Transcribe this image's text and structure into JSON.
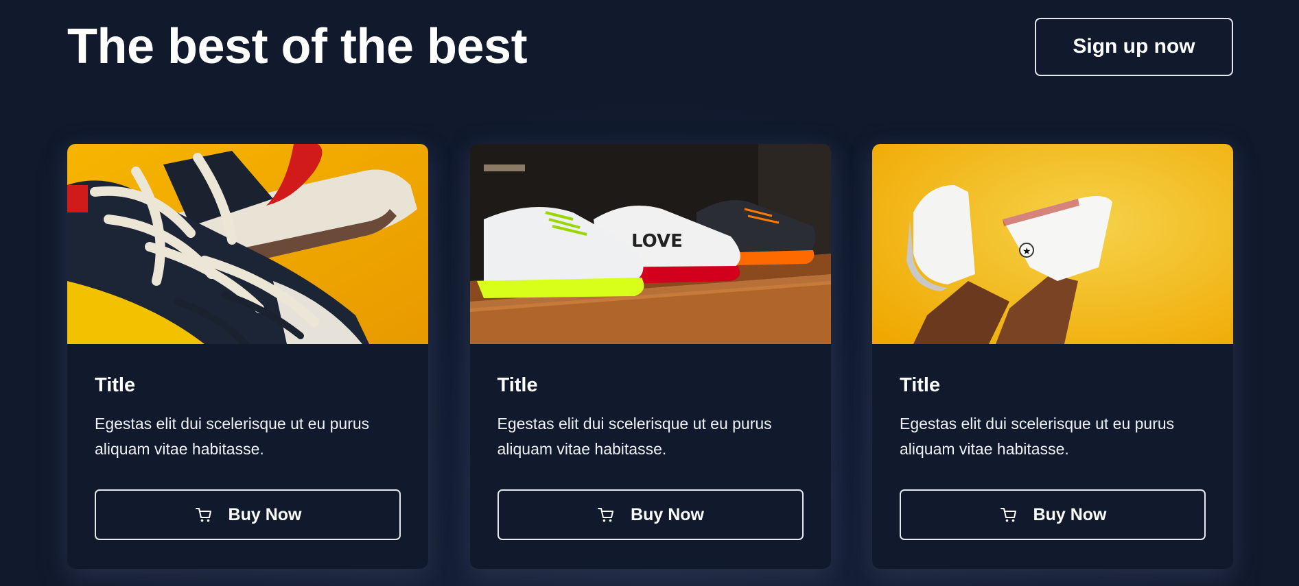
{
  "header": {
    "title": "The best of the best",
    "signup_label": "Sign up now"
  },
  "cards": [
    {
      "title": "Title",
      "description": "Egestas elit dui scelerisque ut eu purus aliquam vitae habitasse.",
      "button_label": "Buy Now",
      "button_icon": "cart-icon",
      "image": "sneaker-closeup-yellow-photo"
    },
    {
      "title": "Title",
      "description": "Egestas elit dui scelerisque ut eu purus aliquam vitae habitasse.",
      "button_label": "Buy Now",
      "button_icon": "cart-icon",
      "image": "sneakers-on-shelf-photo",
      "image_text": "LOVE"
    },
    {
      "title": "Title",
      "description": "Egestas elit dui scelerisque ut eu purus aliquam vitae habitasse.",
      "button_label": "Buy Now",
      "button_icon": "cart-icon",
      "image": "white-hightops-yellow-wall-photo"
    }
  ],
  "colors": {
    "background": "#111a2d",
    "border": "#e6e9ef",
    "text": "#ffffff",
    "accent_yellow": "#f2b705"
  }
}
